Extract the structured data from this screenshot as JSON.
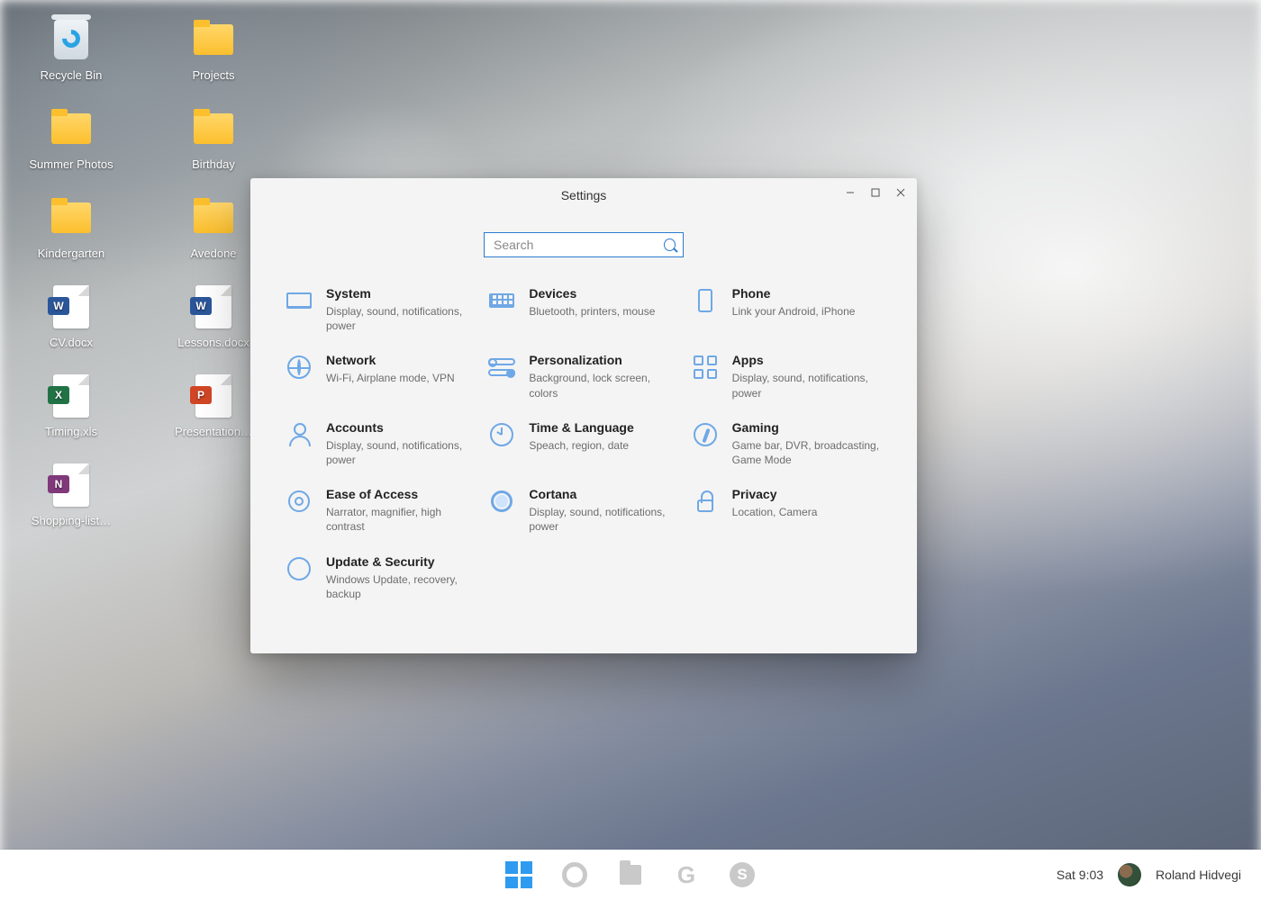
{
  "desktop_icons": {
    "col1": [
      {
        "type": "bin",
        "label": "Recycle Bin"
      },
      {
        "type": "folder",
        "label": "Summer Photos"
      },
      {
        "type": "folder",
        "label": "Kindergarten"
      },
      {
        "type": "word",
        "label": "CV.docx"
      },
      {
        "type": "excel",
        "label": "Timing.xls"
      },
      {
        "type": "onenote",
        "label": "Shopping-list…"
      }
    ],
    "col2": [
      {
        "type": "folder",
        "label": "Projects"
      },
      {
        "type": "folder",
        "label": "Birthday"
      },
      {
        "type": "folder",
        "label": "Avedone"
      },
      {
        "type": "word",
        "label": "Lessons.docx"
      },
      {
        "type": "ppt",
        "label": "Presentation…"
      }
    ]
  },
  "settings": {
    "title": "Settings",
    "search_placeholder": "Search",
    "categories": [
      {
        "id": "system",
        "title": "System",
        "desc": "Display, sound, notifications, power"
      },
      {
        "id": "devices",
        "title": "Devices",
        "desc": "Bluetooth, printers, mouse"
      },
      {
        "id": "phone",
        "title": "Phone",
        "desc": "Link your Android, iPhone"
      },
      {
        "id": "network",
        "title": "Network",
        "desc": "Wi-Fi, Airplane mode, VPN"
      },
      {
        "id": "personalization",
        "title": "Personalization",
        "desc": "Background, lock screen, colors"
      },
      {
        "id": "apps",
        "title": "Apps",
        "desc": "Display, sound, notifications, power"
      },
      {
        "id": "accounts",
        "title": "Accounts",
        "desc": "Display, sound, notifications, power"
      },
      {
        "id": "time",
        "title": "Time & Language",
        "desc": "Speach, region, date"
      },
      {
        "id": "gaming",
        "title": "Gaming",
        "desc": "Game bar, DVR, broadcasting, Game Mode"
      },
      {
        "id": "ease",
        "title": "Ease of Access",
        "desc": "Narrator, magnifier, high contrast"
      },
      {
        "id": "cortana",
        "title": "Cortana",
        "desc": "Display, sound, notifications, power"
      },
      {
        "id": "privacy",
        "title": "Privacy",
        "desc": "Location, Camera"
      },
      {
        "id": "update",
        "title": "Update & Security",
        "desc": "Windows Update, recovery, backup"
      }
    ]
  },
  "taskbar": {
    "clock": "Sat 9:03",
    "user_name": "Roland Hidvegi"
  },
  "doc_badges": {
    "word": "W",
    "excel": "X",
    "ppt": "P",
    "onenote": "N"
  }
}
